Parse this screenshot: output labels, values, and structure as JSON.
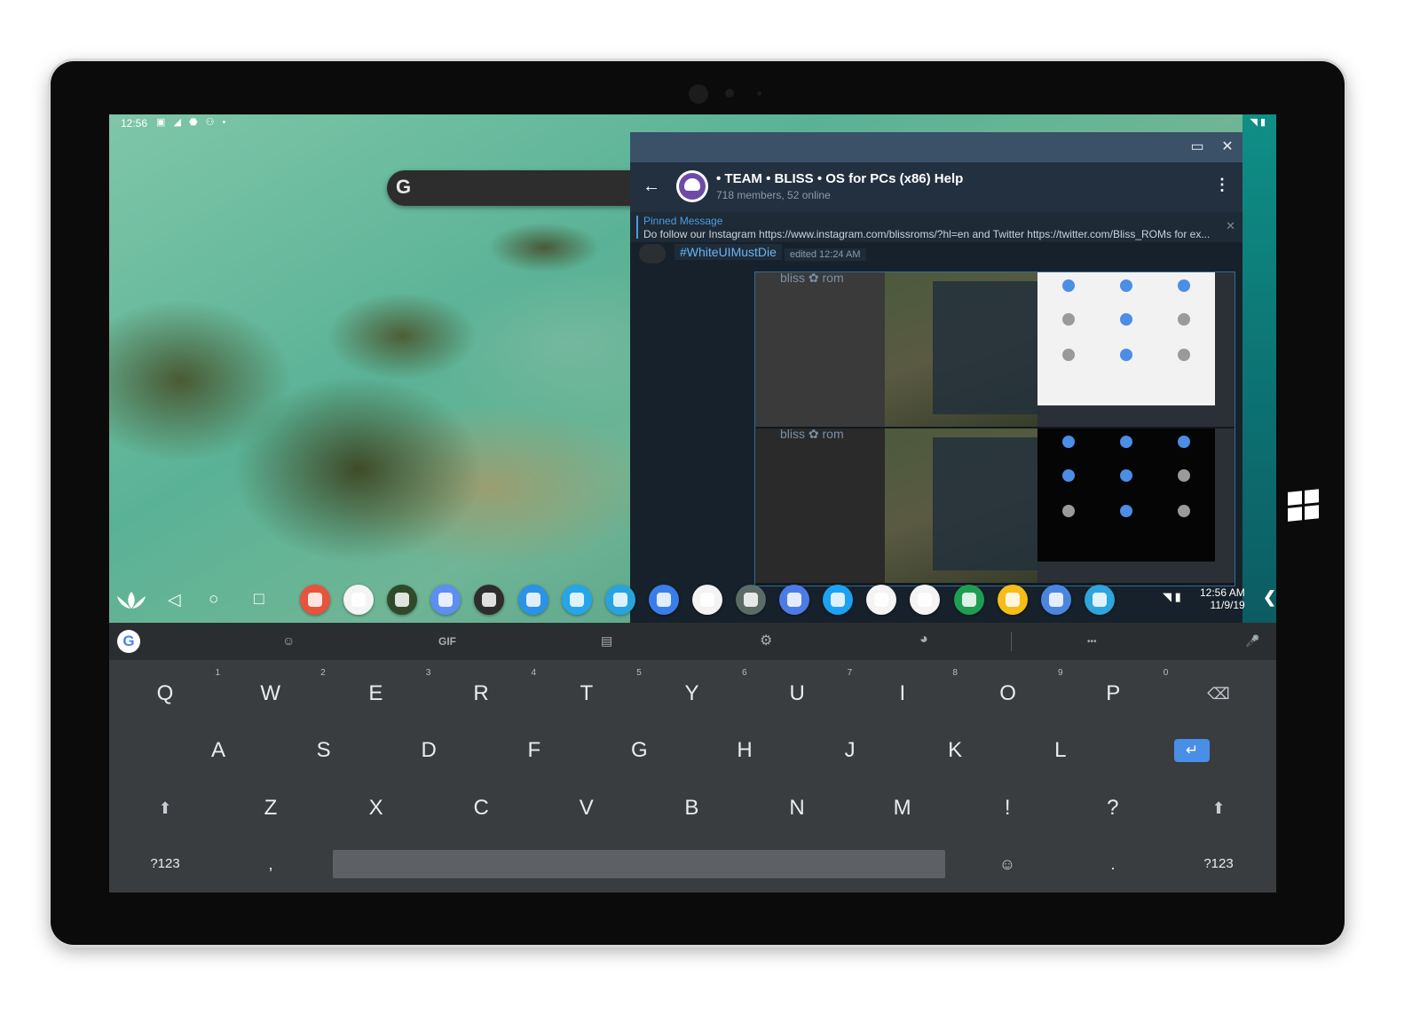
{
  "statusbar": {
    "time": "12:56",
    "left_icons": "▣ ◢ ⬣ ⚇ •",
    "right_icons": "◥ ▮"
  },
  "desktop": {
    "search_logo": "G"
  },
  "telegram": {
    "window_buttons": {
      "minimize": "▭",
      "close": "✕"
    },
    "back": "←",
    "chat_title": "• TEAM • BLISS • OS for PCs (x86) Help",
    "chat_subtitle": "718 members, 52 online",
    "menu": "⋮",
    "pinned_title": "Pinned Message",
    "pinned_text": "Do follow our Instagram https://www.instagram.com/blissroms/?hl=en  and  Twitter https://twitter.com/Bliss_ROMs for ex...",
    "pinned_close": "✕",
    "hashtag": "#WhiteUIMustDie",
    "edited": "edited 12:24 AM",
    "album_brand": "bliss  ✿  rom"
  },
  "taskbar": {
    "nav": {
      "back": "◁",
      "home": "○",
      "recents": "□"
    },
    "apps": [
      {
        "name": "equalizer-app",
        "color": "#e8533b"
      },
      {
        "name": "chrome-app",
        "color": "#f4f4f4"
      },
      {
        "name": "rotation-app",
        "color": "#2f4a2a"
      },
      {
        "name": "palette-app",
        "color": "#5d8ff0"
      },
      {
        "name": "hammer-app",
        "color": "#2d2d2d"
      },
      {
        "name": "bliss-app",
        "color": "#2a93e6"
      },
      {
        "name": "globe-app",
        "color": "#26a6e8"
      },
      {
        "name": "gallery-app",
        "color": "#27a4e0"
      },
      {
        "name": "files-app",
        "color": "#3b7de8"
      },
      {
        "name": "slack-app",
        "color": "#f3f3f3"
      },
      {
        "name": "keyboard-app",
        "color": "#5b6b66"
      },
      {
        "name": "translate-app",
        "color": "#4c7be8"
      },
      {
        "name": "twitter-app",
        "color": "#1da1f2"
      },
      {
        "name": "play-store-app",
        "color": "#f4f4f4"
      },
      {
        "name": "gmail-app",
        "color": "#f4f4f4"
      },
      {
        "name": "hangouts-app",
        "color": "#1f9e52"
      },
      {
        "name": "keep-app",
        "color": "#f6bd18"
      },
      {
        "name": "settings-app",
        "color": "#4a86e0"
      },
      {
        "name": "telegram-app",
        "color": "#2ea5dc"
      }
    ],
    "tray": "◥ ▮",
    "clock_time": "12:56 AM",
    "clock_date": "11/9/19",
    "chevron": "❮"
  },
  "keyboard": {
    "toolbar": {
      "google": "G",
      "sticker": "☺",
      "gif": "GIF",
      "clipboard": "▤",
      "settings": "⚙",
      "theme": "◕",
      "more": "•••",
      "mic": "🎤"
    },
    "row1": [
      {
        "label": "Q",
        "hint": "1"
      },
      {
        "label": "W",
        "hint": "2"
      },
      {
        "label": "E",
        "hint": "3"
      },
      {
        "label": "R",
        "hint": "4"
      },
      {
        "label": "T",
        "hint": "5"
      },
      {
        "label": "Y",
        "hint": "6"
      },
      {
        "label": "U",
        "hint": "7"
      },
      {
        "label": "I",
        "hint": "8"
      },
      {
        "label": "O",
        "hint": "9"
      },
      {
        "label": "P",
        "hint": "0"
      }
    ],
    "backspace": "⌫",
    "row2": [
      "A",
      "S",
      "D",
      "F",
      "G",
      "H",
      "J",
      "K",
      "L"
    ],
    "enter": "↵",
    "shift": "⬆",
    "row3": [
      "Z",
      "X",
      "C",
      "V",
      "B",
      "N",
      "M",
      "!",
      "?"
    ],
    "symbols": "?123",
    "comma": ",",
    "emoji": "☺",
    "period": "."
  }
}
